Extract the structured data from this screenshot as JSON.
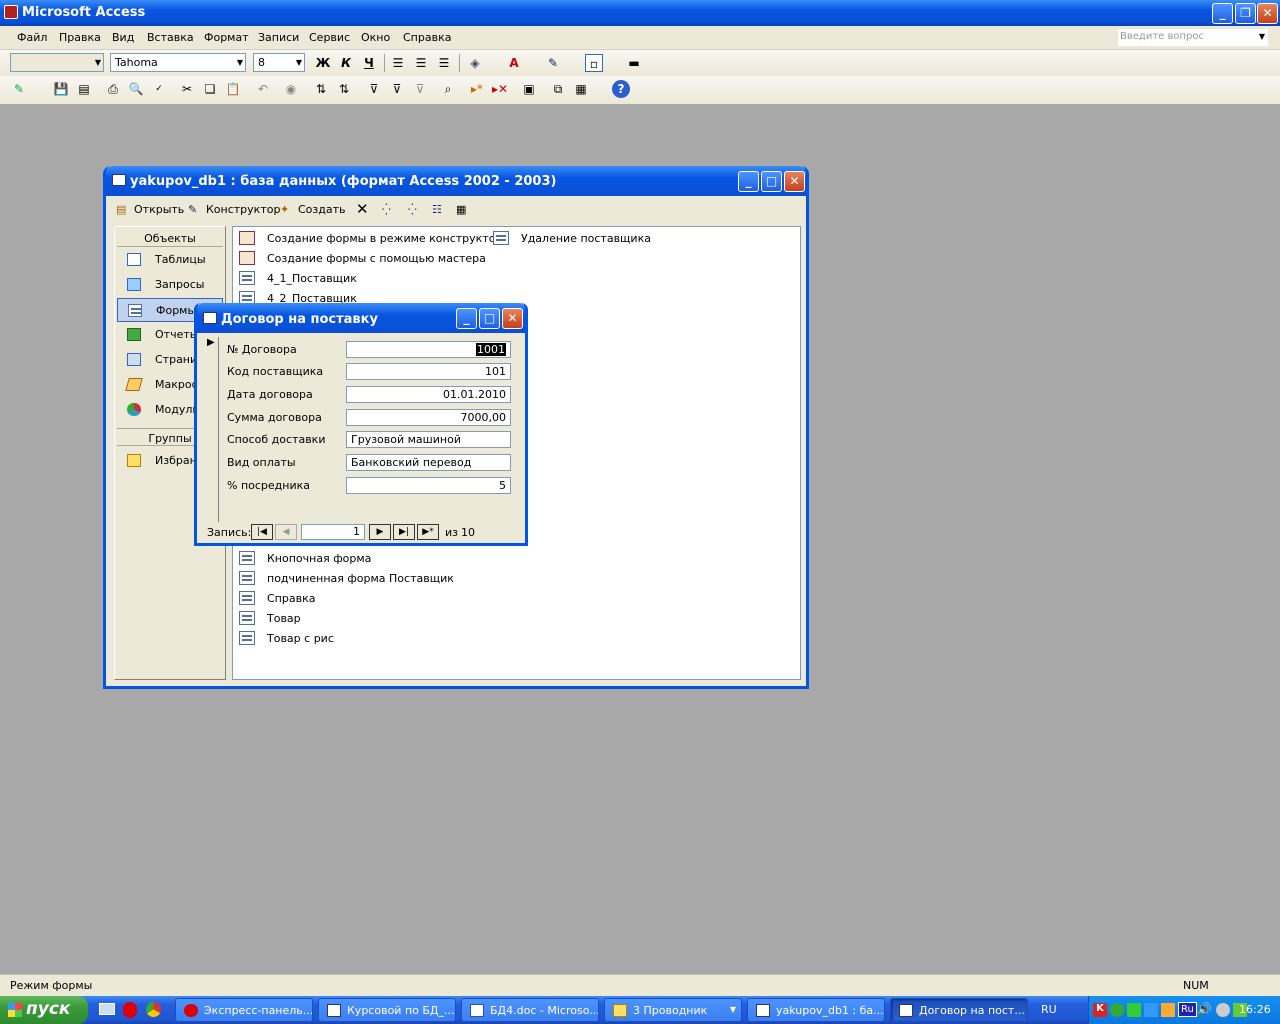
{
  "app": {
    "title": "Microsoft Access"
  },
  "menu": {
    "items": [
      "Файл",
      "Правка",
      "Вид",
      "Вставка",
      "Формат",
      "Записи",
      "Сервис",
      "Окно",
      "Справка"
    ],
    "ask_placeholder": "Введите вопрос"
  },
  "format_toolbar": {
    "object_combo": "",
    "font": "Tahoma",
    "size": "8",
    "bold": "Ж",
    "italic": "К",
    "underline": "Ч"
  },
  "db_window": {
    "title": "yakupov_db1 : база данных (формат Access 2002 - 2003)",
    "toolbar": {
      "open": "Открыть",
      "design": "Конструктор",
      "create": "Создать"
    },
    "objects_header": "Объекты",
    "groups_header": "Группы",
    "nav": [
      {
        "label": "Таблицы"
      },
      {
        "label": "Запросы"
      },
      {
        "label": "Формы"
      },
      {
        "label": "Отчеты"
      },
      {
        "label": "Страниц"
      },
      {
        "label": "Макросы"
      },
      {
        "label": "Модули"
      }
    ],
    "favorites": "Избранн",
    "forms_col1_top": [
      {
        "label": "Создание формы в режиме конструктора"
      },
      {
        "label": "Создание формы с помощью мастера"
      },
      {
        "label": "4_1_Поставщик"
      },
      {
        "label": "4_2_Поставщик"
      }
    ],
    "forms_col1_bottom": [
      {
        "label": "Кнопочная форма"
      },
      {
        "label": "подчиненная форма Поставщик"
      },
      {
        "label": "Справка"
      },
      {
        "label": "Товар"
      },
      {
        "label": "Товар с рис"
      }
    ],
    "forms_col2": [
      {
        "label": "Удаление поставщика"
      }
    ]
  },
  "form_window": {
    "title": "Договор на поставку",
    "fields": [
      {
        "label": "№ Договора",
        "value": "1001"
      },
      {
        "label": "Код поставщика",
        "value": "101"
      },
      {
        "label": "Дата договора",
        "value": "01.01.2010"
      },
      {
        "label": "Сумма договора",
        "value": "7000,00"
      },
      {
        "label": "Способ доставки",
        "value": "Грузовой машиной"
      },
      {
        "label": "Вид оплаты",
        "value": "Банковский перевод"
      },
      {
        "label": "% посредника",
        "value": "5"
      }
    ],
    "nav": {
      "label": "Запись:",
      "current": "1",
      "of_label": "из",
      "total": "10"
    }
  },
  "status": {
    "left": "Режим формы",
    "right": "NUM"
  },
  "taskbar": {
    "start": "пуск",
    "buttons": [
      {
        "label": "Экспресс-панель..."
      },
      {
        "label": "Курсовой по БД_..."
      },
      {
        "label": "БД4.doc - Microso..."
      },
      {
        "label": "3 Проводник"
      },
      {
        "label": "yakupov_db1 : ба..."
      },
      {
        "label": "Договор на пост..."
      }
    ],
    "lang": "RU",
    "tray_lang": "Ru",
    "clock": "16:26"
  }
}
